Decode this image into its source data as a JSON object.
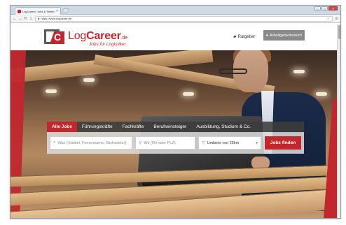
{
  "browser": {
    "tab_title": "LogCareer: Jobs & Stellenan...",
    "tab_close": "×",
    "url": "https://www.logcareer.de",
    "window_buttons": [
      "–",
      "□",
      "✕"
    ]
  },
  "header": {
    "logo_part1": "Log",
    "logo_part2": "Career",
    "logo_tld": ".de",
    "logo_letter": "C",
    "tagline": "Jobs für Logistiker",
    "ratgeber_label": "Ratgeber",
    "employer_label": "Arbeitgeberbereich"
  },
  "search": {
    "tabs": [
      {
        "label": "Alle Jobs",
        "active": true
      },
      {
        "label": "Führungskräfte",
        "active": false
      },
      {
        "label": "Fachkräfte",
        "active": false
      },
      {
        "label": "Berufseinsteiger",
        "active": false
      },
      {
        "label": "Ausbildung, Studium & Co.",
        "active": false
      }
    ],
    "what_placeholder": "Was (Jobtitel, Firmenname, Stichwörter)",
    "where_placeholder": "Wo (Ort oder PLZ)",
    "radius_value": "Umkreis von 25km",
    "submit_label": "Jobs finden"
  },
  "colors": {
    "brand_red": "#c1272d",
    "employer_grey": "#8a8a8a"
  },
  "icons": {
    "search": "search-icon",
    "location": "location-pin-icon",
    "radius": "filter-icon",
    "ratgeber": "book-icon",
    "employer": "user-icon"
  }
}
